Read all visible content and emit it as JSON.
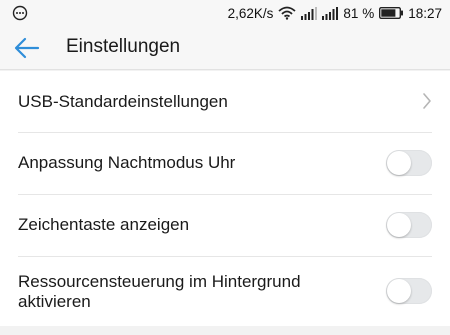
{
  "status_bar": {
    "net_speed": "2,62K/s",
    "battery_percent": "81 %",
    "time": "18:27",
    "icons": [
      "notification-dots-icon",
      "wifi-icon",
      "signal-icon",
      "signal-icon",
      "battery-icon"
    ],
    "battery_level": 0.81
  },
  "app_bar": {
    "title": "Einstellungen",
    "back_icon": "arrow-left-icon",
    "accent_color": "#2f8ed9"
  },
  "settings": [
    {
      "label": "USB-Standardeinstellungen",
      "control": "chevron"
    },
    {
      "label": "Anpassung Nachtmodus Uhr",
      "control": "toggle",
      "enabled": false
    },
    {
      "label": "Zeichentaste anzeigen",
      "control": "toggle",
      "enabled": false
    },
    {
      "label_line1": "Ressourcensteuerung im Hintergrund",
      "label_line2": "aktivieren",
      "control": "toggle",
      "enabled": false
    }
  ]
}
